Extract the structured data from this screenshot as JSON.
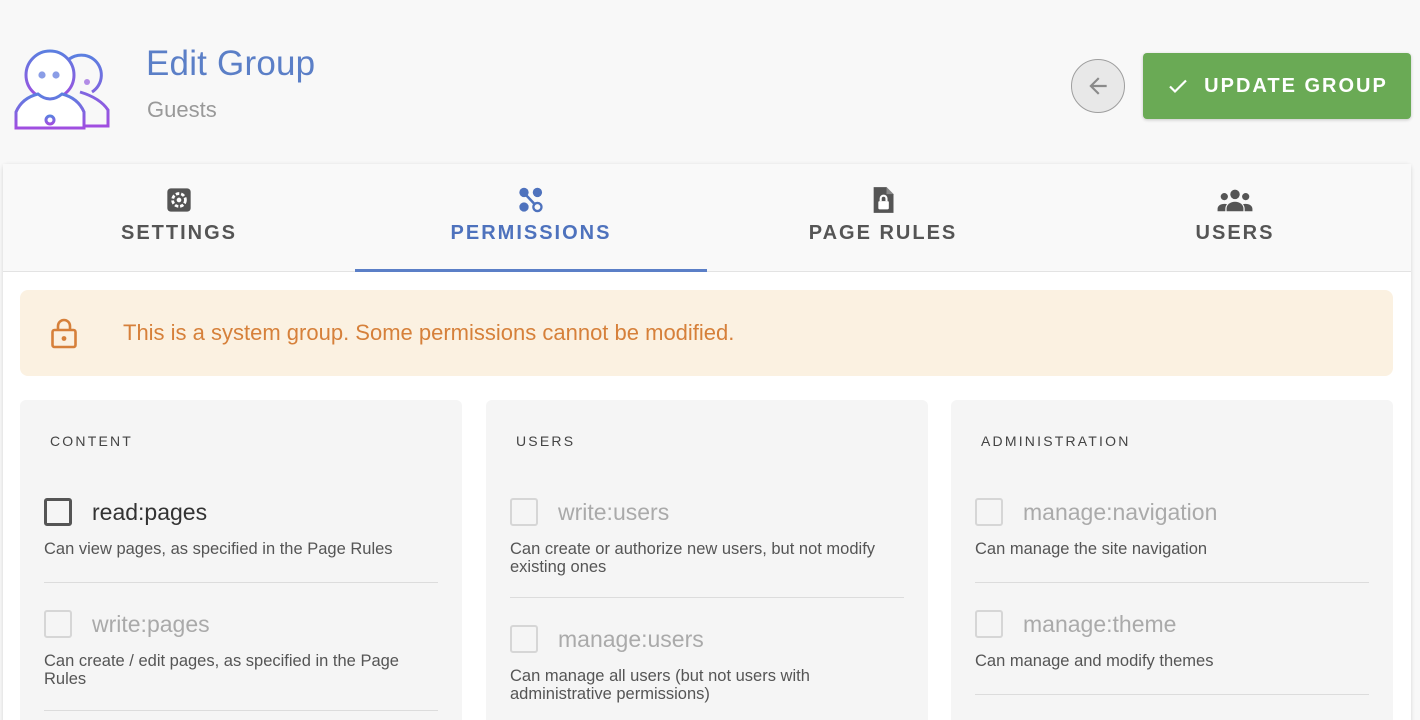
{
  "header": {
    "title": "Edit Group",
    "subtitle": "Guests",
    "group_icon": "group-users-icon",
    "back_icon": "arrow-left-icon",
    "update_icon": "check-icon",
    "update_label": "UPDATE GROUP"
  },
  "tabs": [
    {
      "label": "SETTINGS",
      "icon": "gear-icon",
      "active": false
    },
    {
      "label": "PERMISSIONS",
      "icon": "permissions-icon",
      "active": true
    },
    {
      "label": "PAGE RULES",
      "icon": "file-lock-icon",
      "active": false
    },
    {
      "label": "USERS",
      "icon": "users-icon",
      "active": false
    }
  ],
  "alert": {
    "icon": "lock-icon",
    "text": "This is a system group. Some permissions cannot be modified."
  },
  "columns": [
    {
      "title": "CONTENT",
      "permissions": [
        {
          "name": "read:pages",
          "desc": "Can view pages, as specified in the Page Rules",
          "enabled": true,
          "checked": false
        },
        {
          "name": "write:pages",
          "desc": "Can create / edit pages, as specified in the Page Rules",
          "enabled": false,
          "checked": false
        }
      ]
    },
    {
      "title": "USERS",
      "permissions": [
        {
          "name": "write:users",
          "desc": "Can create or authorize new users, but not modify existing ones",
          "enabled": false,
          "checked": false
        },
        {
          "name": "manage:users",
          "desc": "Can manage all users (but not users with administrative permissions)",
          "enabled": false,
          "checked": false
        }
      ]
    },
    {
      "title": "ADMINISTRATION",
      "permissions": [
        {
          "name": "manage:navigation",
          "desc": "Can manage the site navigation",
          "enabled": false,
          "checked": false
        },
        {
          "name": "manage:theme",
          "desc": "Can manage and modify themes",
          "enabled": false,
          "checked": false
        }
      ]
    }
  ],
  "colors": {
    "accent": "#5b7fc7",
    "update_button": "#6aaa55",
    "alert_bg": "#fbf1e1",
    "alert_text": "#d6803a",
    "icon_gradient_start": "#5b7fe0",
    "icon_gradient_end": "#a04ee0"
  }
}
